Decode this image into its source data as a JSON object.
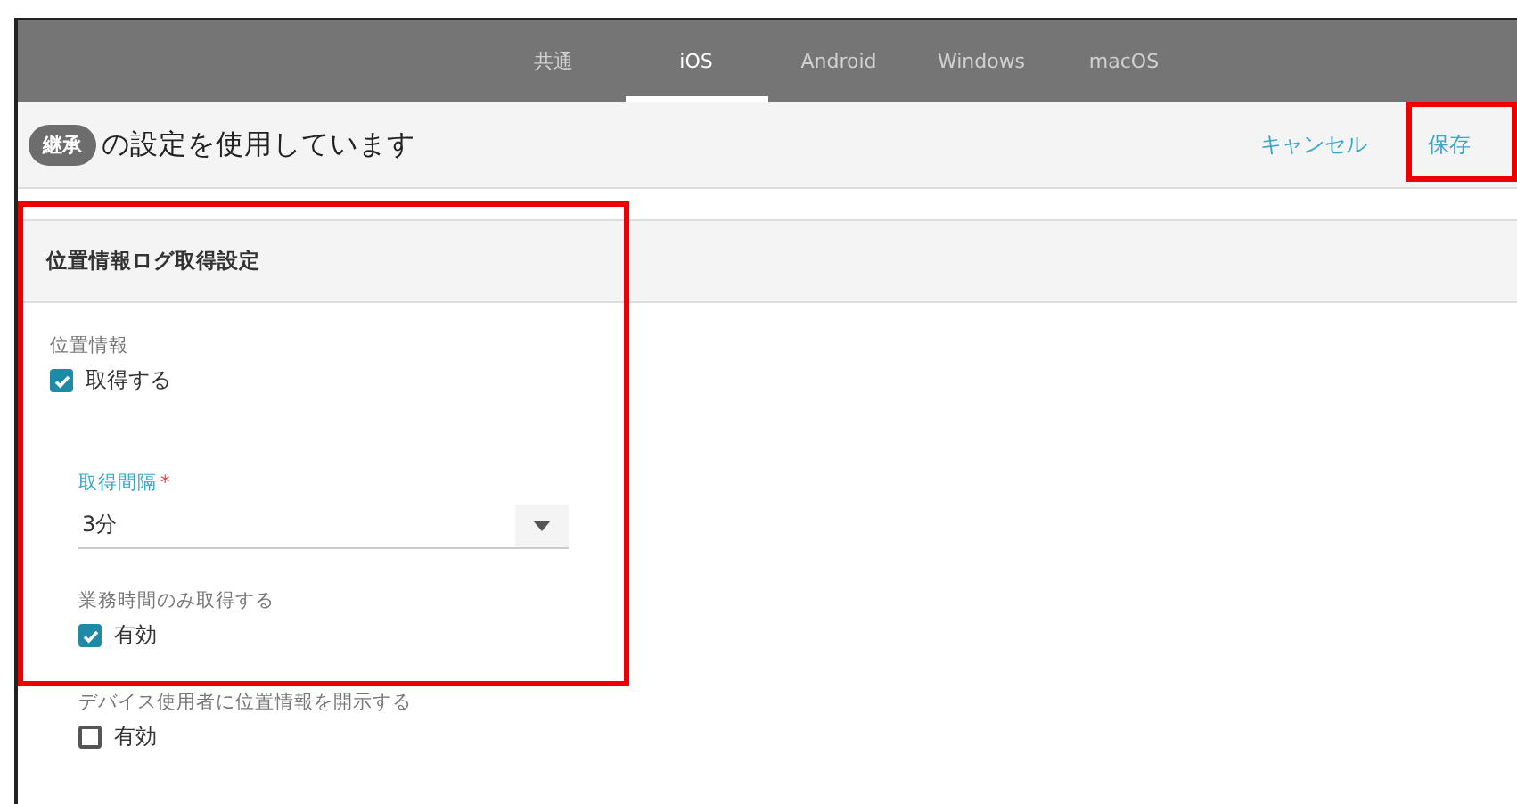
{
  "tabs": [
    {
      "label": "共通",
      "selected": false
    },
    {
      "label": "iOS",
      "selected": true
    },
    {
      "label": "Android",
      "selected": false
    },
    {
      "label": "Windows",
      "selected": false
    },
    {
      "label": "macOS",
      "selected": false
    }
  ],
  "header": {
    "badge": "継承",
    "text": "の設定を使用しています",
    "actions": [
      {
        "label": "キャンセル",
        "highlighted": false
      },
      {
        "label": "保存",
        "highlighted": true
      }
    ]
  },
  "section": {
    "title": "位置情報ログ取得設定",
    "highlighted": true,
    "fields": [
      {
        "kind": "checkbox",
        "label": "位置情報",
        "option": "取得する",
        "checked": true,
        "children": [
          {
            "kind": "select",
            "label": "取得間隔",
            "required_mark": "*",
            "value": "3分"
          },
          {
            "kind": "checkbox",
            "label": "業務時間のみ取得する",
            "option": "有効",
            "checked": true
          },
          {
            "kind": "checkbox",
            "label": "デバイス使用者に位置情報を開示する",
            "option": "有効",
            "checked": false
          }
        ]
      }
    ]
  }
}
